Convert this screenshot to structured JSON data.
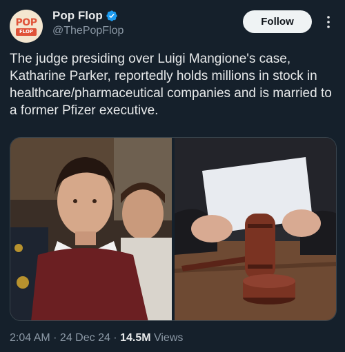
{
  "author": {
    "display_name": "Pop Flop",
    "handle": "@ThePopFlop",
    "avatar_logo_top": "POP",
    "avatar_logo_bottom": "FLOP",
    "verified": true
  },
  "actions": {
    "follow_label": "Follow",
    "more_icon": "more-vertical-icon"
  },
  "tweet": {
    "text": "The judge presiding over Luigi Mangione's case, Katharine Parker, reportedly holds millions in stock in healthcare/pharmaceutical companies and is married to a former Pfizer executive."
  },
  "media": {
    "images": [
      "photo of young man in red sweater being escorted",
      "photo of judge's gavel and papers"
    ]
  },
  "meta": {
    "time": "2:04 AM",
    "sep1": " · ",
    "date": "24 Dec 24",
    "sep2": " · ",
    "views_count": "14.5M",
    "views_label": " Views"
  },
  "colors": {
    "background": "#15202b",
    "verified": "#1d9bf0",
    "secondary_text": "#8b98a5"
  }
}
